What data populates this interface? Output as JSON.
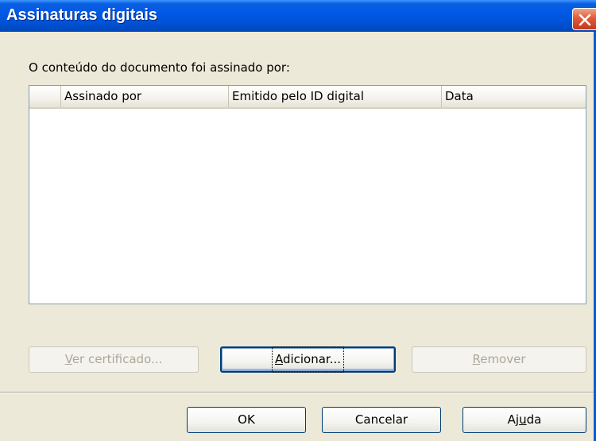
{
  "window": {
    "title": "Assinaturas digitais"
  },
  "signatures": {
    "intro_label": "O conteúdo do documento foi assinado por:",
    "columns": [
      "",
      "Assinado por",
      "Emitido pelo ID digital",
      "Data"
    ],
    "rows": []
  },
  "actions": {
    "view_certificate": {
      "label": "Ver certificado...",
      "mnemonic": "V",
      "rest": "er certificado...",
      "enabled": false
    },
    "add": {
      "label": "Adicionar...",
      "mnemonic": "A",
      "rest": "dicionar...",
      "enabled": true
    },
    "remove": {
      "label": "Remover",
      "mnemonic": "R",
      "rest": "emover",
      "enabled": false
    }
  },
  "footer": {
    "ok": "OK",
    "cancel": "Cancelar",
    "help": {
      "label": "Ajuda",
      "pre": "Aj",
      "mnemonic": "u",
      "post": "da"
    }
  },
  "colors": {
    "titlebar": "#0058e6",
    "dialog_bg": "#ece9d8",
    "close_button": "#e15a3a",
    "button_border": "#003c74"
  }
}
